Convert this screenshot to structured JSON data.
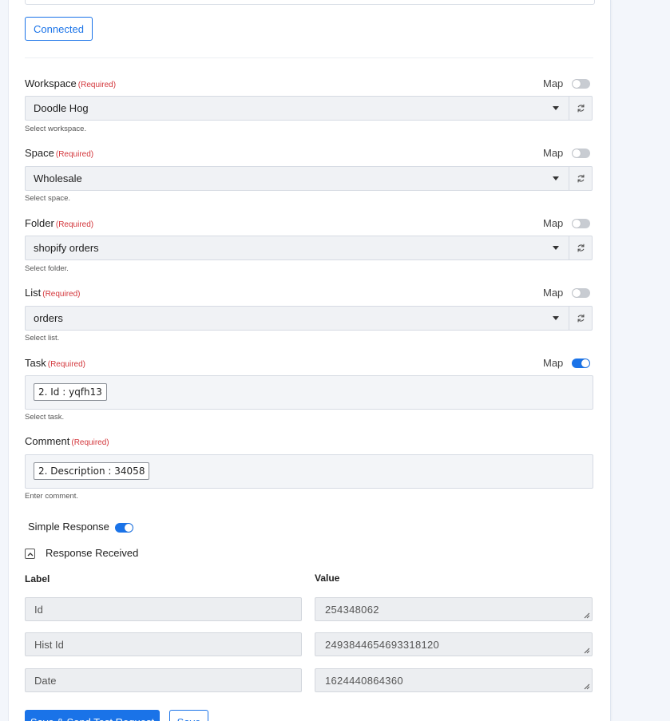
{
  "connect": {
    "button_label": "Connected"
  },
  "map_label": "Map",
  "required_label": "(Required)",
  "fields": {
    "workspace": {
      "label": "Workspace",
      "value": "Doodle Hog",
      "help": "Select workspace.",
      "mapped": false
    },
    "space": {
      "label": "Space",
      "value": "Wholesale",
      "help": "Select space.",
      "mapped": false
    },
    "folder": {
      "label": "Folder",
      "value": "shopify orders",
      "help": "Select folder.",
      "mapped": false
    },
    "list": {
      "label": "List",
      "value": "orders",
      "help": "Select list.",
      "mapped": false
    },
    "task": {
      "label": "Task",
      "chip": "2. Id : yqfh13",
      "help": "Select task.",
      "mapped": true
    },
    "comment": {
      "label": "Comment",
      "chip": "2. Description : 34058",
      "help": "Enter comment."
    }
  },
  "simple_response": {
    "label": "Simple Response",
    "enabled": true
  },
  "response": {
    "title": "Response Received",
    "col_label": "Label",
    "col_value": "Value",
    "rows": [
      {
        "label": "Id",
        "value": "254348062"
      },
      {
        "label": "Hist Id",
        "value": "2493844654693318120"
      },
      {
        "label": "Date",
        "value": "1624440864360"
      }
    ]
  },
  "actions": {
    "primary_label": "Save & Send Test Request",
    "secondary_label": "Save"
  },
  "colors": {
    "accent": "#1a73e8",
    "required": "#d3363b"
  }
}
